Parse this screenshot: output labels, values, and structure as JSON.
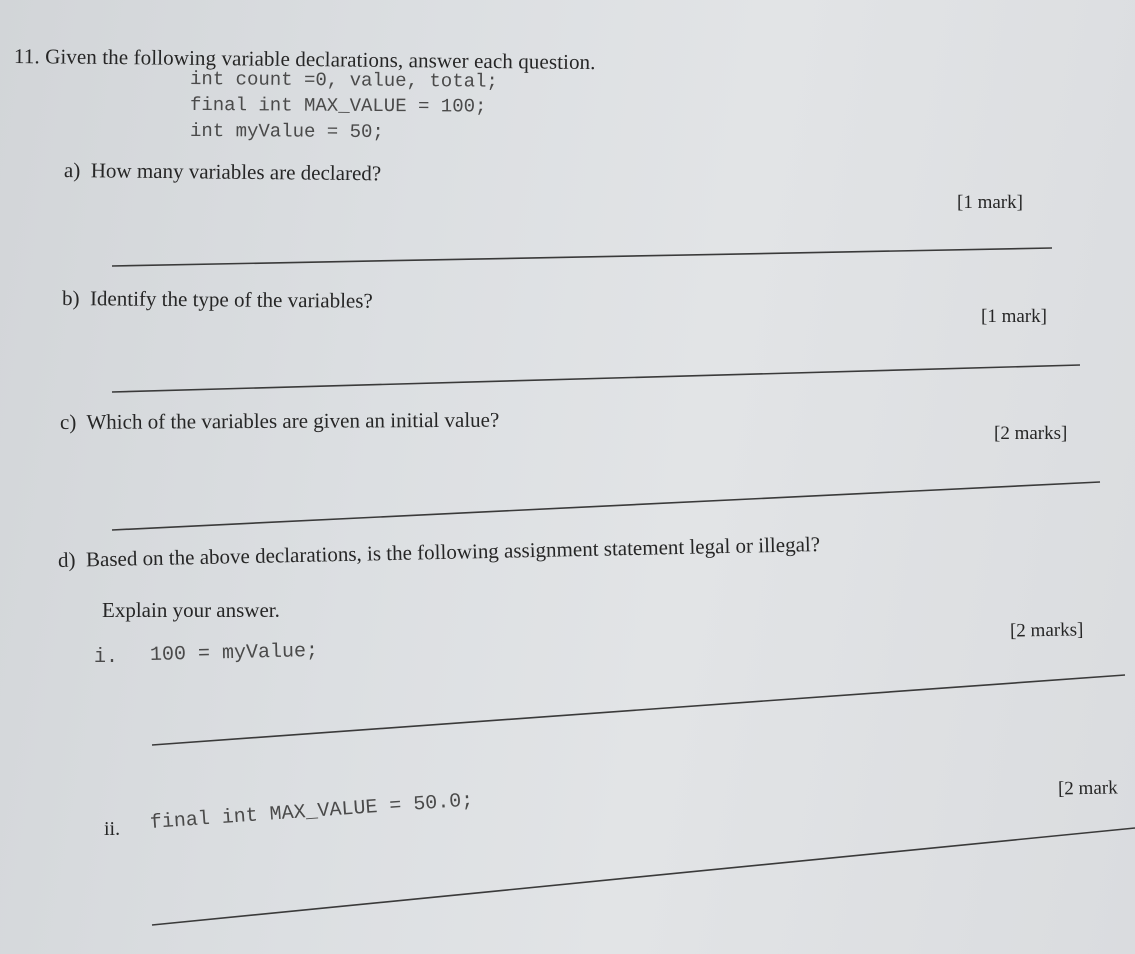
{
  "question": {
    "number": "11.",
    "title": "Given the following variable declarations, answer each question.",
    "code_lines": [
      "int count =0, value, total;",
      "final int MAX_VALUE = 100;",
      "int myValue = 50;"
    ]
  },
  "parts": [
    {
      "label": "a)",
      "text": "How many variables are declared?",
      "marks": "[1 mark]"
    },
    {
      "label": "b)",
      "text": "Identify the type of the variables?",
      "marks": "[1 mark]"
    },
    {
      "label": "c)",
      "text": "Which of the variables are given an initial value?",
      "marks": "[2 marks]"
    },
    {
      "label": "d)",
      "text": "Based on the above declarations, is the following assignment statement legal or illegal?",
      "subtext": "Explain your answer.",
      "subparts": [
        {
          "label": "i.",
          "code": "100 = myValue;",
          "marks": "[2 marks]"
        },
        {
          "label": "ii.",
          "code": "final int MAX_VALUE = 50.0;",
          "marks": "[2 mark"
        }
      ]
    }
  ]
}
